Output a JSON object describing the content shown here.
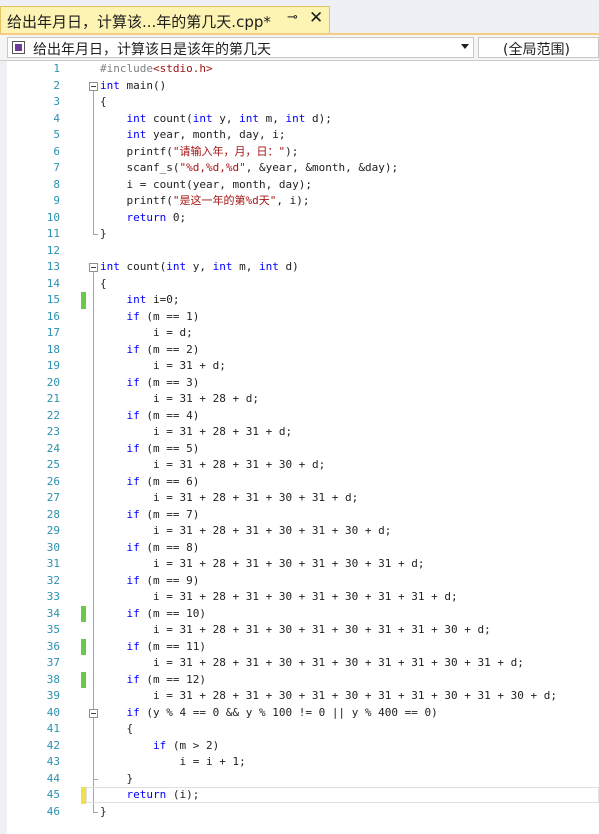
{
  "tab": {
    "title": "给出年月日，计算该...年的第几天.cpp*",
    "pin_icon": "pin-icon",
    "close_icon": "close-icon"
  },
  "navbar": {
    "function_dropdown": "给出年月日，计算该日是该年的第几天",
    "scope_dropdown": "(全局范围)"
  },
  "editor": {
    "lines": [
      {
        "num": "1",
        "text": "#include<stdio.h>",
        "change": "none"
      },
      {
        "num": "2",
        "text": "int main()",
        "change": "none"
      },
      {
        "num": "3",
        "text": "{",
        "change": "none"
      },
      {
        "num": "4",
        "text": "    int count(int y, int m, int d);",
        "change": "none"
      },
      {
        "num": "5",
        "text": "    int year, month, day, i;",
        "change": "none"
      },
      {
        "num": "6",
        "text": "    printf(\"请输入年，月，日：\");",
        "change": "none"
      },
      {
        "num": "7",
        "text": "    scanf_s(\"%d,%d,%d\", &year, &month, &day);",
        "change": "none"
      },
      {
        "num": "8",
        "text": "    i = count(year, month, day);",
        "change": "none"
      },
      {
        "num": "9",
        "text": "    printf(\"是这一年的第%d天\", i);",
        "change": "none"
      },
      {
        "num": "10",
        "text": "    return 0;",
        "change": "none"
      },
      {
        "num": "11",
        "text": "}",
        "change": "none"
      },
      {
        "num": "12",
        "text": "",
        "change": "none"
      },
      {
        "num": "13",
        "text": "int count(int y, int m, int d)",
        "change": "none"
      },
      {
        "num": "14",
        "text": "{",
        "change": "none"
      },
      {
        "num": "15",
        "text": "    int i=0;",
        "change": "saved"
      },
      {
        "num": "16",
        "text": "    if (m == 1)",
        "change": "none"
      },
      {
        "num": "17",
        "text": "        i = d;",
        "change": "none"
      },
      {
        "num": "18",
        "text": "    if (m == 2)",
        "change": "none"
      },
      {
        "num": "19",
        "text": "        i = 31 + d;",
        "change": "none"
      },
      {
        "num": "20",
        "text": "    if (m == 3)",
        "change": "none"
      },
      {
        "num": "21",
        "text": "        i = 31 + 28 + d;",
        "change": "none"
      },
      {
        "num": "22",
        "text": "    if (m == 4)",
        "change": "none"
      },
      {
        "num": "23",
        "text": "        i = 31 + 28 + 31 + d;",
        "change": "none"
      },
      {
        "num": "24",
        "text": "    if (m == 5)",
        "change": "none"
      },
      {
        "num": "25",
        "text": "        i = 31 + 28 + 31 + 30 + d;",
        "change": "none"
      },
      {
        "num": "26",
        "text": "    if (m == 6)",
        "change": "none"
      },
      {
        "num": "27",
        "text": "        i = 31 + 28 + 31 + 30 + 31 + d;",
        "change": "none"
      },
      {
        "num": "28",
        "text": "    if (m == 7)",
        "change": "none"
      },
      {
        "num": "29",
        "text": "        i = 31 + 28 + 31 + 30 + 31 + 30 + d;",
        "change": "none"
      },
      {
        "num": "30",
        "text": "    if (m == 8)",
        "change": "none"
      },
      {
        "num": "31",
        "text": "        i = 31 + 28 + 31 + 30 + 31 + 30 + 31 + d;",
        "change": "none"
      },
      {
        "num": "32",
        "text": "    if (m == 9)",
        "change": "none"
      },
      {
        "num": "33",
        "text": "        i = 31 + 28 + 31 + 30 + 31 + 30 + 31 + 31 + d;",
        "change": "none"
      },
      {
        "num": "34",
        "text": "    if (m == 10)",
        "change": "saved"
      },
      {
        "num": "35",
        "text": "        i = 31 + 28 + 31 + 30 + 31 + 30 + 31 + 31 + 30 + d;",
        "change": "none"
      },
      {
        "num": "36",
        "text": "    if (m == 11)",
        "change": "saved"
      },
      {
        "num": "37",
        "text": "        i = 31 + 28 + 31 + 30 + 31 + 30 + 31 + 31 + 30 + 31 + d;",
        "change": "none"
      },
      {
        "num": "38",
        "text": "    if (m == 12)",
        "change": "saved"
      },
      {
        "num": "39",
        "text": "        i = 31 + 28 + 31 + 30 + 31 + 30 + 31 + 31 + 30 + 31 + 30 + d;",
        "change": "none"
      },
      {
        "num": "40",
        "text": "    if (y % 4 == 0 && y % 100 != 0 || y % 400 == 0)",
        "change": "none"
      },
      {
        "num": "41",
        "text": "    {",
        "change": "none"
      },
      {
        "num": "42",
        "text": "        if (m > 2)",
        "change": "none"
      },
      {
        "num": "43",
        "text": "            i = i + 1;",
        "change": "none"
      },
      {
        "num": "44",
        "text": "    }",
        "change": "none"
      },
      {
        "num": "45",
        "text": "    return (i);",
        "change": "unsaved"
      },
      {
        "num": "46",
        "text": "}",
        "change": "none"
      }
    ]
  },
  "colors": {
    "keyword": "#0000ff",
    "string": "#a31515",
    "line_number": "#2b91af",
    "saved_change": "#6cc84a",
    "unsaved_change": "#f0e04a",
    "tab_active": "#fdf3b3"
  }
}
